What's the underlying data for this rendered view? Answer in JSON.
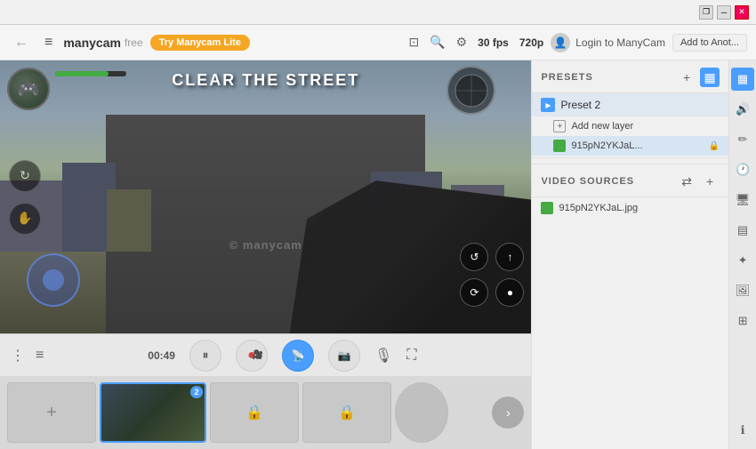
{
  "titlebar": {
    "controls": {
      "resize_label": "❐",
      "minimize_label": "─",
      "close_label": "✕"
    }
  },
  "topbar": {
    "back_label": "←",
    "menu_label": "≡",
    "logo": "manycam",
    "logo_suffix": "free",
    "try_button": "Try Manycam Lite",
    "fps_label": "30 fps",
    "resolution_label": "720p",
    "login_label": "Login to ManyCam",
    "add_to_another_label": "Add to Anot..."
  },
  "video": {
    "mission_title": "Clear The Street",
    "watermark": "© manycam",
    "health_percent": 75
  },
  "controls": {
    "time": "00:49",
    "pause_icon": "⏸",
    "record_icon": "●",
    "broadcast_icon": "📡",
    "screenshot_icon": "📷",
    "mic_icon": "🎙",
    "expand_icon": "⛶",
    "dots_icon": "⋮",
    "list_icon": "≡"
  },
  "presets": {
    "title": "PRESETS",
    "add_icon": "+",
    "grid_icon": "▦",
    "preset_name": "Preset 2",
    "add_layer_label": "Add new layer",
    "layer_name": "915pN2YKJaL...",
    "lock_icon": "🔒"
  },
  "video_sources": {
    "title": "VIDEO SOURCES",
    "adjust_icon": "⇄",
    "add_icon": "+",
    "source_name": "915pN2YKJaL.jpg"
  },
  "sidebar_icons": {
    "volume": "🔊",
    "brush": "✏",
    "clock": "🕐",
    "monitor": "🖥",
    "layers": "▤",
    "magic": "✦",
    "image": "🖼",
    "grid": "⊞",
    "info": "ℹ"
  },
  "thumbnails": {
    "add_label": "+",
    "badge_label": "2",
    "lock_label": "🔒",
    "nav_label": "›"
  }
}
